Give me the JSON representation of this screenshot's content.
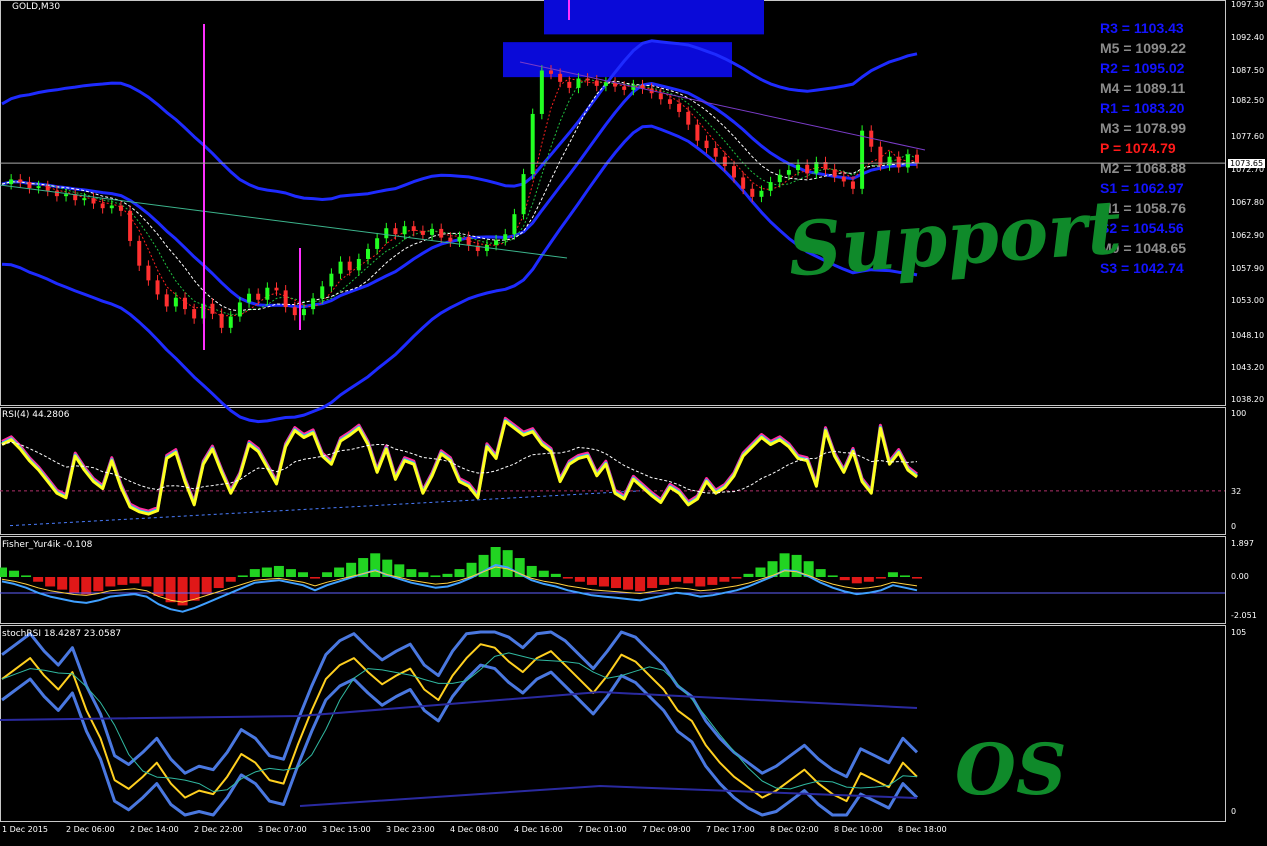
{
  "panels": {
    "main_title": "GOLD,M30",
    "rsi_title": "RSI(4) 44.2806",
    "fisher_title": "Fisher_Yur4ik -0.108",
    "stoch_title": "stochRSI 18.4287 23.0587"
  },
  "pivots": [
    {
      "text": "R3 = 1103.43",
      "color": "#1414ff"
    },
    {
      "text": "M5 = 1099.22",
      "color": "#8c8c8c"
    },
    {
      "text": "R2 = 1095.02",
      "color": "#1414ff"
    },
    {
      "text": "M4 = 1089.11",
      "color": "#8c8c8c"
    },
    {
      "text": "R1 = 1083.20",
      "color": "#1414ff"
    },
    {
      "text": "M3 = 1078.99",
      "color": "#8c8c8c"
    },
    {
      "text": "P  = 1074.79",
      "color": "#ff1a1a"
    },
    {
      "text": "M2 = 1068.88",
      "color": "#8c8c8c"
    },
    {
      "text": "S1 = 1062.97",
      "color": "#1414ff"
    },
    {
      "text": "M1 = 1058.76",
      "color": "#8c8c8c"
    },
    {
      "text": "S2 = 1054.56",
      "color": "#1414ff"
    },
    {
      "text": "M0 = 1048.65",
      "color": "#8c8c8c"
    },
    {
      "text": "S3 = 1042.74",
      "color": "#1414ff"
    }
  ],
  "annotations": {
    "support": "Support",
    "os": "OS"
  },
  "current_price": "1073.65",
  "chart_data": {
    "type": "line",
    "price_axis": [
      "1097.30",
      "1092.40",
      "1087.50",
      "1082.50",
      "1077.60",
      "1072.70",
      "1067.80",
      "1062.90",
      "1057.90",
      "1053.00",
      "1048.10",
      "1043.20",
      "1038.20"
    ],
    "time_labels": [
      "1 Dec 2015",
      "2 Dec 06:00",
      "2 Dec 14:00",
      "2 Dec 22:00",
      "3 Dec 07:00",
      "3 Dec 15:00",
      "3 Dec 23:00",
      "4 Dec 08:00",
      "4 Dec 16:00",
      "7 Dec 01:00",
      "7 Dec 09:00",
      "7 Dec 17:00",
      "8 Dec 02:00",
      "8 Dec 10:00",
      "8 Dec 18:00"
    ],
    "rsi_axis": [
      "100",
      "32",
      "0"
    ],
    "fisher_axis": [
      "1.897",
      "0.00",
      "-2.051"
    ],
    "stoch_axis": [
      "105",
      "0"
    ],
    "price": [
      1070.5,
      1071.2,
      1070.8,
      1069.9,
      1070.2,
      1069.5,
      1068.7,
      1069.0,
      1068.1,
      1068.4,
      1067.6,
      1066.9,
      1067.3,
      1066.5,
      1062.0,
      1058.3,
      1056.1,
      1054.0,
      1052.2,
      1053.5,
      1051.8,
      1050.4,
      1052.6,
      1051.1,
      1049.0,
      1050.7,
      1052.8,
      1054.1,
      1053.2,
      1055.0,
      1054.6,
      1052.1,
      1050.9,
      1051.8,
      1053.4,
      1055.2,
      1057.1,
      1058.9,
      1057.6,
      1059.3,
      1060.8,
      1062.4,
      1063.9,
      1063.0,
      1064.2,
      1063.5,
      1062.9,
      1063.8,
      1062.5,
      1061.9,
      1062.6,
      1061.3,
      1060.5,
      1061.4,
      1062.1,
      1063.0,
      1066.0,
      1072.0,
      1081.0,
      1087.5,
      1087.0,
      1085.8,
      1084.9,
      1086.3,
      1086.0,
      1085.2,
      1085.7,
      1085.1,
      1084.6,
      1085.3,
      1084.8,
      1084.1,
      1083.2,
      1082.5,
      1081.3,
      1079.4,
      1077.0,
      1075.9,
      1074.6,
      1073.2,
      1071.5,
      1069.8,
      1068.6,
      1069.5,
      1070.8,
      1071.9,
      1072.6,
      1073.4,
      1072.1,
      1073.8,
      1072.7,
      1071.6,
      1070.9,
      1069.8,
      1078.5,
      1076.1,
      1073.3,
      1074.6,
      1073.0,
      1074.9,
      1073.65
    ],
    "rsi": [
      72,
      76,
      68,
      58,
      50,
      40,
      30,
      26,
      62,
      50,
      40,
      34,
      58,
      35,
      18,
      14,
      12,
      15,
      60,
      65,
      40,
      20,
      55,
      68,
      48,
      30,
      45,
      72,
      66,
      52,
      38,
      70,
      84,
      78,
      82,
      62,
      55,
      75,
      80,
      86,
      72,
      48,
      68,
      42,
      58,
      55,
      30,
      45,
      64,
      58,
      40,
      36,
      26,
      70,
      60,
      92,
      86,
      80,
      83,
      72,
      66,
      40,
      55,
      60,
      62,
      45,
      55,
      30,
      25,
      42,
      35,
      28,
      22,
      35,
      30,
      20,
      25,
      40,
      30,
      35,
      45,
      62,
      70,
      78,
      72,
      76,
      70,
      60,
      58,
      36,
      84,
      62,
      48,
      66,
      40,
      30,
      86,
      55,
      65,
      50,
      44
    ],
    "fisher": [
      0.6,
      0.4,
      0.1,
      -0.3,
      -0.6,
      -0.8,
      -1.0,
      -1.1,
      -0.9,
      -0.6,
      -0.5,
      -0.4,
      -0.6,
      -1.2,
      -1.6,
      -1.8,
      -1.5,
      -1.1,
      -0.7,
      -0.3,
      0.1,
      0.5,
      0.6,
      0.7,
      0.5,
      0.3,
      -0.1,
      0.3,
      0.6,
      0.9,
      1.2,
      1.5,
      1.1,
      0.8,
      0.5,
      0.3,
      0.1,
      0.2,
      0.5,
      0.9,
      1.4,
      1.9,
      1.7,
      1.2,
      0.7,
      0.4,
      0.2,
      -0.1,
      -0.3,
      -0.5,
      -0.6,
      -0.7,
      -0.8,
      -0.9,
      -0.7,
      -0.5,
      -0.3,
      -0.4,
      -0.6,
      -0.5,
      -0.3,
      -0.1,
      0.2,
      0.6,
      1.0,
      1.5,
      1.4,
      1.0,
      0.5,
      0.1,
      -0.2,
      -0.4,
      -0.3,
      -0.1,
      0.3,
      0.1,
      -0.1
    ],
    "stoch_k": [
      78,
      84,
      90,
      80,
      72,
      82,
      60,
      44,
      20,
      15,
      22,
      30,
      18,
      10,
      14,
      12,
      22,
      35,
      30,
      20,
      18,
      40,
      60,
      78,
      86,
      90,
      82,
      75,
      80,
      84,
      72,
      66,
      80,
      90,
      98,
      96,
      88,
      82,
      90,
      94,
      86,
      78,
      70,
      80,
      92,
      88,
      80,
      72,
      60,
      54,
      40,
      30,
      22,
      16,
      10,
      14,
      20,
      26,
      18,
      12,
      8,
      24,
      20,
      16,
      30,
      22
    ]
  }
}
